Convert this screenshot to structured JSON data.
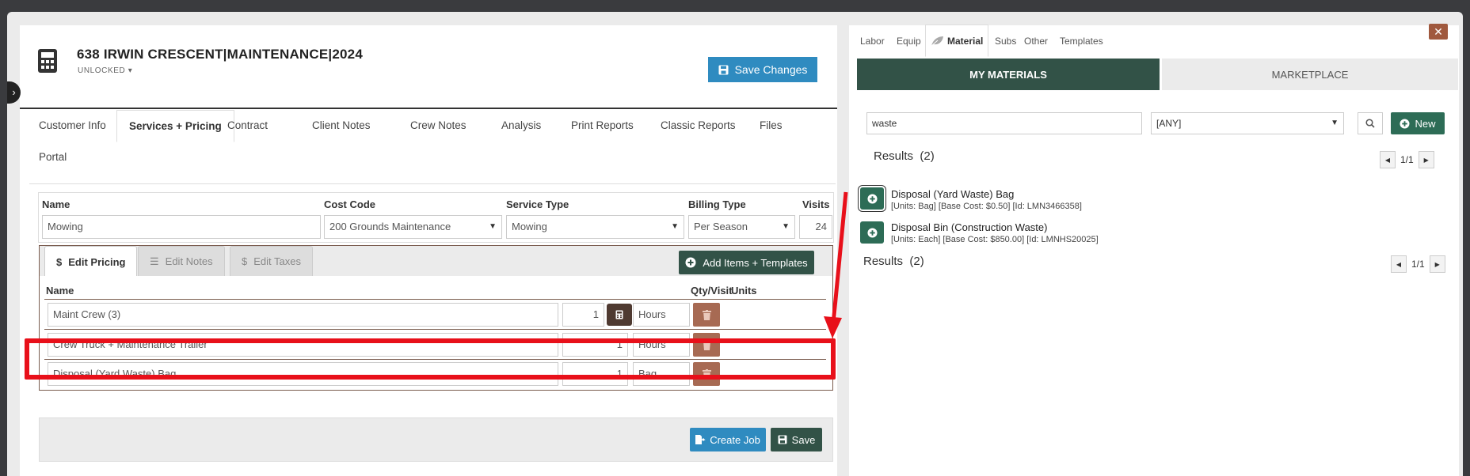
{
  "header": {
    "title": "638 IRWIN CRESCENT|MAINTENANCE|2024",
    "status": "UNLOCKED",
    "save_changes": "Save Changes"
  },
  "tabs": [
    "Customer Info",
    "Services + Pricing",
    "Contract",
    "Client Notes",
    "Crew Notes",
    "Analysis",
    "Print Reports",
    "Classic Reports",
    "Files",
    "Portal"
  ],
  "service": {
    "columns": [
      "Name",
      "Cost Code",
      "Service Type",
      "Billing Type",
      "Visits"
    ],
    "name": "Mowing",
    "cost_code": "200 Grounds Maintenance",
    "service_type": "Mowing",
    "billing_type": "Per Season",
    "visits": "24"
  },
  "pricing_tabs": [
    "Edit Pricing",
    "Edit Notes",
    "Edit Taxes"
  ],
  "add_items_label": "Add Items + Templates",
  "items_columns": [
    "Name",
    "Qty/Visit",
    "Units"
  ],
  "items": [
    {
      "name": "Maint Crew (3)",
      "qty": "1",
      "units": "Hours"
    },
    {
      "name": "Crew Truck + Maintenance Trailer",
      "qty": "1",
      "units": "Hours"
    },
    {
      "name": "Disposal (Yard Waste) Bag",
      "qty": "1",
      "units": "Bag"
    }
  ],
  "footer": {
    "create_job": "Create Job",
    "save": "Save"
  },
  "right": {
    "tabs": [
      "Labor",
      "Equip",
      "Material",
      "Subs",
      "Other",
      "Templates"
    ],
    "subtabs": [
      "MY MATERIALS",
      "MARKETPLACE"
    ],
    "search_value": "waste",
    "filter_value": "[ANY]",
    "new_label": "New",
    "results_label": "Results",
    "results_count": "(2)",
    "page": "1/1",
    "materials": [
      {
        "name": "Disposal (Yard Waste) Bag",
        "meta": "[Units: Bag] [Base Cost: $0.50] [Id: LMN3466358]"
      },
      {
        "name": "Disposal Bin (Construction Waste)",
        "meta": "[Units: Each] [Base Cost: $850.00] [Id: LMNHS20025]"
      }
    ],
    "results2_label": "Results",
    "results2_count": "(2)",
    "page2": "1/1"
  },
  "colors": {
    "accent_green": "#325247",
    "accent_blue": "#2f8bc0",
    "trash": "#a76a53",
    "highlight": "#e8101a"
  }
}
